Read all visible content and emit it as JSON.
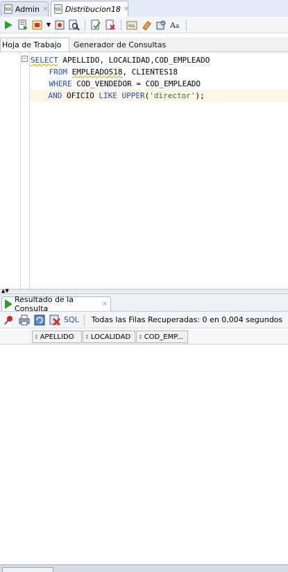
{
  "doc_tabs": [
    {
      "label": "Admin",
      "active": false
    },
    {
      "label": "Distribucion18",
      "active": true
    }
  ],
  "subtabs": {
    "worksheet": "Hoja de Trabajo",
    "query_builder": "Generador de Consultas"
  },
  "editor": {
    "lines": [
      {
        "text": "SELECT APELLIDO, LOCALIDAD,COD_EMPLEADO"
      },
      {
        "text": "    FROM EMPLEADOS18, CLIENTES18"
      },
      {
        "text": "    WHERE COD_VENDEDOR = COD_EMPLEADO"
      },
      {
        "text": "    AND OFICIO LIKE UPPER('director');"
      }
    ],
    "tokens": {
      "l1_kw": "SELECT",
      "l1_rest": " APELLIDO, LOCALIDAD,COD_EMPLEADO",
      "l2_indent": "    ",
      "l2_kw": "FROM",
      "l2_space": " ",
      "l2_table": "EMPLEADOS18",
      "l2_rest": ", CLIENTES18",
      "l3_indent": "    ",
      "l3_kw": "WHERE",
      "l3_rest": " COD_VENDEDOR = COD_EMPLEADO",
      "l4_indent": "    ",
      "l4_kw1": "AND",
      "l4_mid": " OFICIO ",
      "l4_kw2": "LIKE",
      "l4_sp": " ",
      "l4_kw3": "UPPER",
      "l4_open": "(",
      "l4_str": "'director'",
      "l4_close": ");"
    }
  },
  "results": {
    "tab_label": "Resultado de la Consulta",
    "sql_link": "SQL",
    "status": "Todas las Filas Recuperadas: 0 en 0,004 segundos",
    "columns": [
      "APELLIDO",
      "LOCALIDAD",
      "COD_EMP..."
    ]
  },
  "icons": {
    "run": "run-statement-icon",
    "run_script": "run-script-icon",
    "accent_green": "#27a32a",
    "keyword_blue": "#1f4fc2"
  }
}
